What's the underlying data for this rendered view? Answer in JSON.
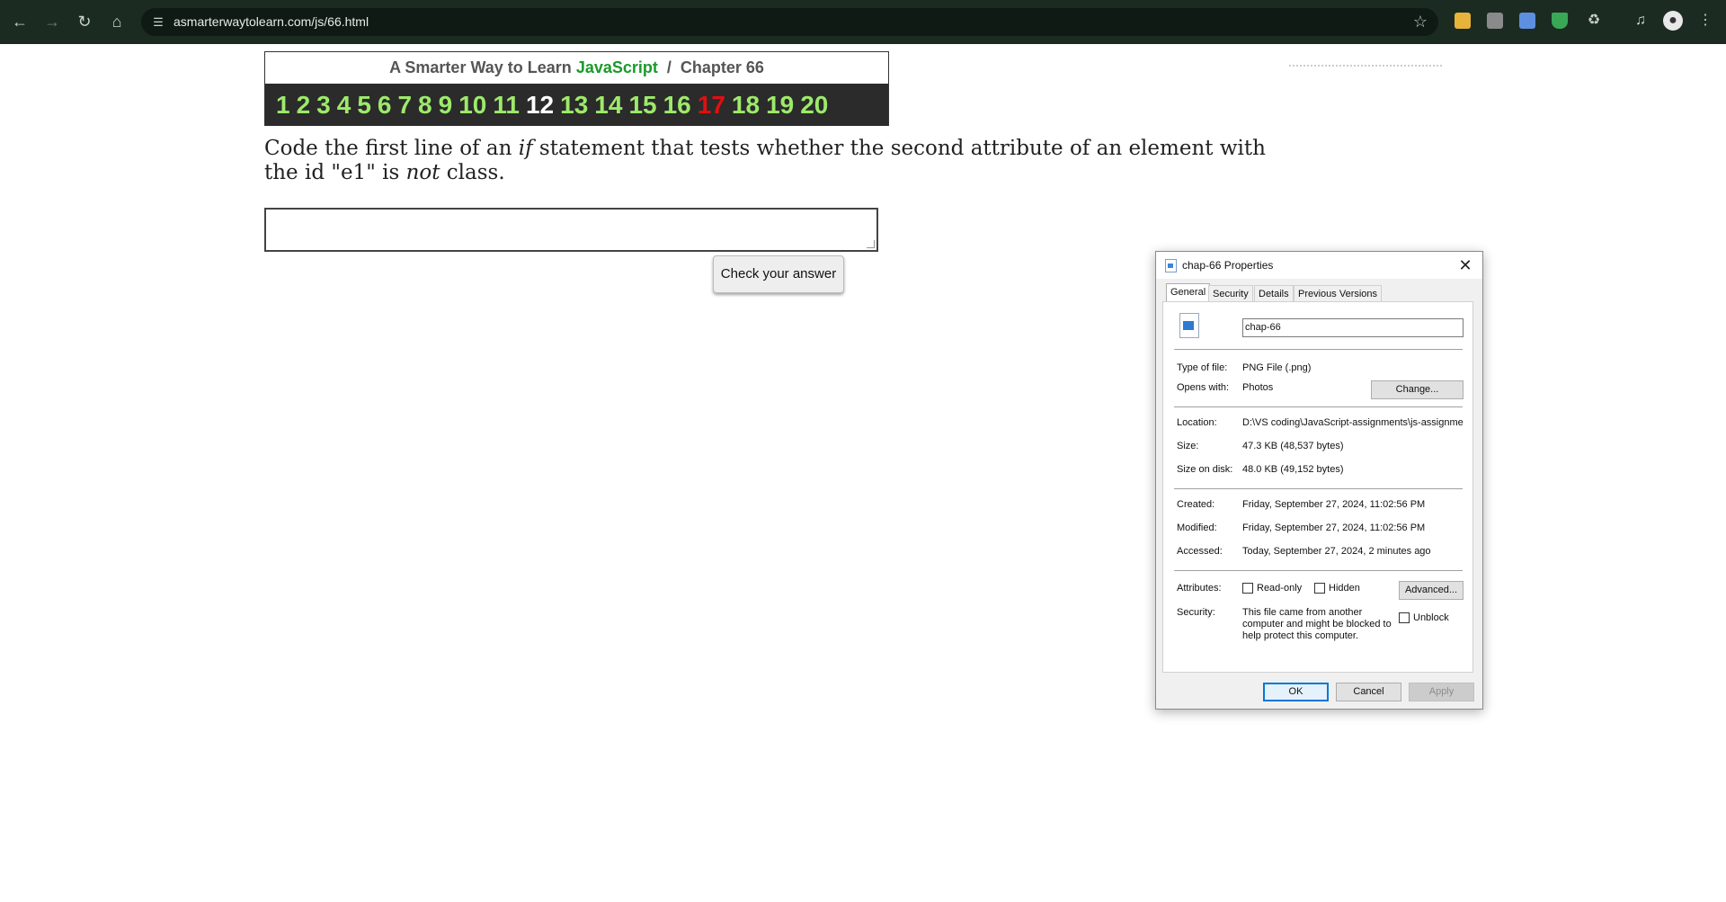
{
  "browser": {
    "url": "asmarterwaytolearn.com/js/66.html",
    "nav_icons": [
      "back-icon",
      "forward-icon",
      "reload-icon",
      "home-icon"
    ]
  },
  "page": {
    "header_prefix": "A Smarter Way to Learn ",
    "header_js": "JavaScript",
    "header_suffix": "  /  Chapter 66",
    "chapters": [
      "1",
      "2",
      "3",
      "4",
      "5",
      "6",
      "7",
      "8",
      "9",
      "10",
      "11",
      "12",
      "13",
      "14",
      "15",
      "16",
      "17",
      "18",
      "19",
      "20"
    ],
    "current_chapter": "12",
    "highlight_chapter": "17",
    "question_part1": "Code the first line of an ",
    "question_if": "if",
    "question_part2": " statement that tests whether the second attribute of an element with the id \"e1\" is ",
    "question_not": "not",
    "question_part3": " class.",
    "answer_value": "",
    "check_button": "Check your answer"
  },
  "dialog": {
    "title": "chap-66 Properties",
    "tabs": [
      "General",
      "Security",
      "Details",
      "Previous Versions"
    ],
    "active_tab": "General",
    "file_name": "chap-66",
    "type_label": "Type of file:",
    "type_value": "PNG File (.png)",
    "opens_label": "Opens with:",
    "opens_value": "Photos",
    "change_button": "Change...",
    "location_label": "Location:",
    "location_value": "D:\\VS coding\\JavaScript-assignments\\js-assignmen",
    "size_label": "Size:",
    "size_value": "47.3 KB (48,537 bytes)",
    "size_disk_label": "Size on disk:",
    "size_disk_value": "48.0 KB (49,152 bytes)",
    "created_label": "Created:",
    "created_value": "Friday, September 27, 2024, 11:02:56 PM",
    "modified_label": "Modified:",
    "modified_value": "Friday, September 27, 2024, 11:02:56 PM",
    "accessed_label": "Accessed:",
    "accessed_value": "Today, September 27, 2024, 2 minutes ago",
    "attributes_label": "Attributes:",
    "readonly_label": "Read-only",
    "hidden_label": "Hidden",
    "advanced_button": "Advanced...",
    "security_label": "Security:",
    "security_text_1": "This file came from another",
    "security_text_2": "computer and might be blocked to",
    "security_text_3": "help protect this computer.",
    "unblock_label": "Unblock",
    "ok_button": "OK",
    "cancel_button": "Cancel",
    "apply_button": "Apply"
  },
  "colors": {
    "chrome_bg": "#1c2b22",
    "chapter_green": "#9dea6a",
    "chapter_red": "#e01010",
    "javascript_green": "#1a9a2a"
  }
}
